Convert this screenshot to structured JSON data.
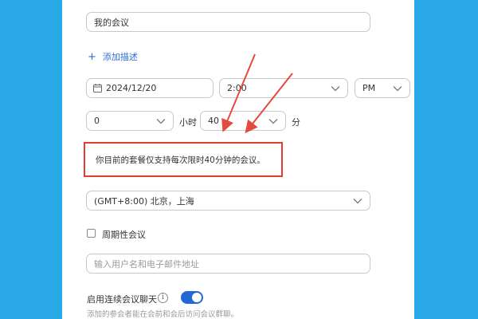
{
  "meeting_topic": {
    "value": "我的会议"
  },
  "add_description": {
    "plus": "+",
    "label": "添加描述"
  },
  "date": {
    "value": "2024/12/20",
    "icon": "calendar-icon"
  },
  "time": {
    "value": "2:00"
  },
  "ampm": {
    "value": "PM"
  },
  "duration": {
    "hours_value": "0",
    "hours_unit": "小时",
    "minutes_value": "40",
    "minutes_unit": "分"
  },
  "notice": {
    "text": "你目前的套餐仅支持每次限时40分钟的会议。"
  },
  "timezone": {
    "value": "(GMT+8:00) 北京，上海"
  },
  "recurring": {
    "label": "周期性会议",
    "checked": false
  },
  "invitees": {
    "placeholder": "输入用户名和电子邮件地址"
  },
  "continuous_chat": {
    "label": "启用连续会议聊天",
    "info": "i",
    "enabled": true,
    "hint": "添加的参会者能在会前和会后访问会议群聊。"
  },
  "colors": {
    "background": "#29a8e6",
    "accent": "#2d6fd6",
    "highlight": "#e23b34",
    "toggle_on": "#2468d8"
  }
}
